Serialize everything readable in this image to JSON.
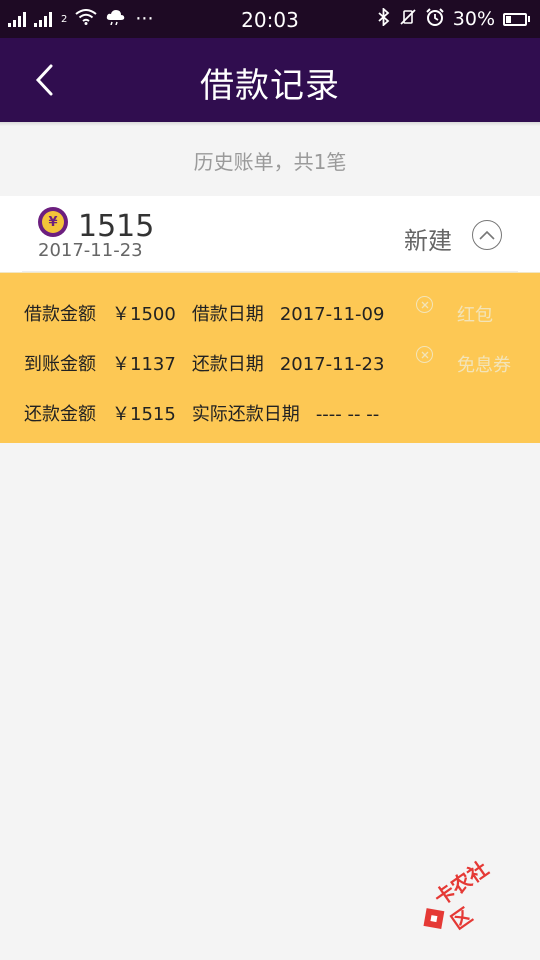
{
  "status_bar": {
    "time": "20:03",
    "sim2_tag": "2",
    "more": "···",
    "battery_text": "30%",
    "battery_level_percent": 30
  },
  "header": {
    "title": "借款记录",
    "back_icon": "chevron-left-icon"
  },
  "summary": "历史账单，共1笔",
  "record": {
    "amount": "1515",
    "date": "2017-11-23",
    "status": "新建"
  },
  "detail": {
    "row1": {
      "label1": "借款金额",
      "value1": "￥1500",
      "label2": "借款日期",
      "value2": "2017-11-09"
    },
    "row2": {
      "label1": "到账金额",
      "value1": "￥1137",
      "label2": "还款日期",
      "value2": "2017-11-23"
    },
    "row3": {
      "label1": "还款金额",
      "value1": "￥1515",
      "label2": "实际还款日期",
      "value2": "---- -- --"
    },
    "coupons": [
      "红包",
      "免息券"
    ]
  },
  "watermark": "卡农社区",
  "colors": {
    "status_bar": "#1e0a24",
    "app_bar": "#300d4f",
    "detail_panel": "#fdc854",
    "accent_purple": "#6c1f7f"
  }
}
